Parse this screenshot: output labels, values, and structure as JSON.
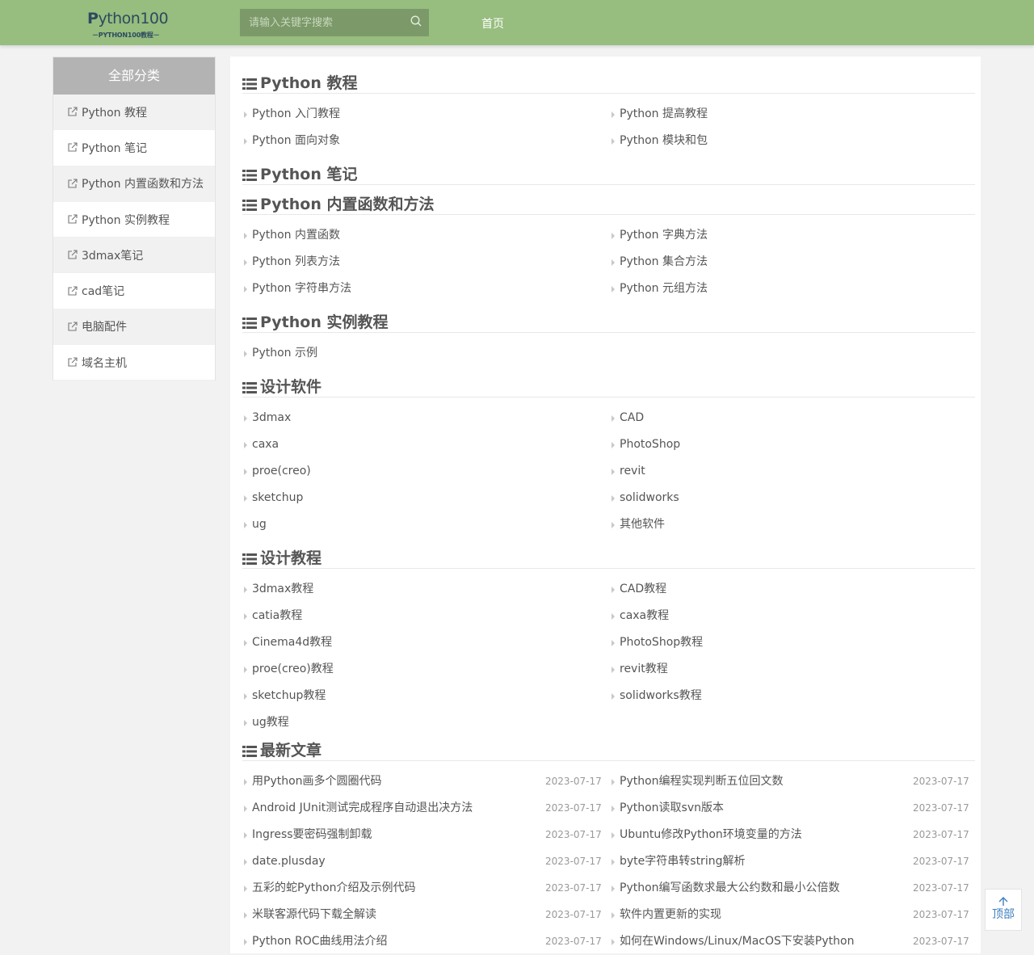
{
  "header": {
    "logo_main_prefix": "P",
    "logo_main_rest": "ython100",
    "logo_sub": "－PYTHON100教程－",
    "search_placeholder": "请输入关键字搜索",
    "nav_home": "首页",
    "colors": {
      "bar": "#97bd7f",
      "search_bg": "#7c9a69"
    }
  },
  "sidebar": {
    "heading": "全部分类",
    "items": [
      {
        "label": "Python 教程"
      },
      {
        "label": "Python 笔记"
      },
      {
        "label": "Python 内置函数和方法"
      },
      {
        "label": "Python 实例教程"
      },
      {
        "label": "3dmax笔记"
      },
      {
        "label": "cad笔记"
      },
      {
        "label": "电脑配件"
      },
      {
        "label": "域名主机"
      }
    ]
  },
  "sections": [
    {
      "title": "Python 教程",
      "items": [
        "Python 入门教程",
        "Python 提高教程",
        "Python 面向对象",
        "Python 模块和包"
      ]
    },
    {
      "title": "Python 笔记",
      "items": []
    },
    {
      "title": "Python 内置函数和方法",
      "items": [
        "Python 内置函数",
        "Python 字典方法",
        "Python 列表方法",
        "Python 集合方法",
        "Python 字符串方法",
        "Python 元组方法"
      ]
    },
    {
      "title": "Python 实例教程",
      "items": [
        "Python 示例"
      ]
    },
    {
      "title": "设计软件",
      "items": [
        "3dmax",
        "CAD",
        "caxa",
        "PhotoShop",
        "proe(creo)",
        "revit",
        "sketchup",
        "solidworks",
        "ug",
        "其他软件"
      ]
    },
    {
      "title": "设计教程",
      "items": [
        "3dmax教程",
        "CAD教程",
        "catia教程",
        "caxa教程",
        "Cinema4d教程",
        "PhotoShop教程",
        "proe(creo)教程",
        "revit教程",
        "sketchup教程",
        "solidworks教程",
        "ug教程"
      ]
    }
  ],
  "latest": {
    "title": "最新文章",
    "articles": [
      {
        "title": "用Python画多个圆圈代码",
        "date": "2023-07-17"
      },
      {
        "title": "Python编程实现判断五位回文数",
        "date": "2023-07-17"
      },
      {
        "title": "Android JUnit测试完成程序自动退出决方法",
        "date": "2023-07-17"
      },
      {
        "title": "Python读取svn版本",
        "date": "2023-07-17"
      },
      {
        "title": "Ingress要密码强制卸载",
        "date": "2023-07-17"
      },
      {
        "title": "Ubuntu修改Python环境变量的方法",
        "date": "2023-07-17"
      },
      {
        "title": "date.plusday",
        "date": "2023-07-17"
      },
      {
        "title": "byte字符串转string解析",
        "date": "2023-07-17"
      },
      {
        "title": "五彩的蛇Python介绍及示例代码",
        "date": "2023-07-17"
      },
      {
        "title": "Python编写函数求最大公约数和最小公倍数",
        "date": "2023-07-17"
      },
      {
        "title": "米联客源代码下载全解读",
        "date": "2023-07-17"
      },
      {
        "title": "软件内置更新的实现",
        "date": "2023-07-17"
      },
      {
        "title": "Python ROC曲线用法介绍",
        "date": "2023-07-17"
      },
      {
        "title": "如何在Windows/Linux/MacOS下安装Python",
        "date": "2023-07-17"
      }
    ]
  },
  "back_to_top": "顶部"
}
